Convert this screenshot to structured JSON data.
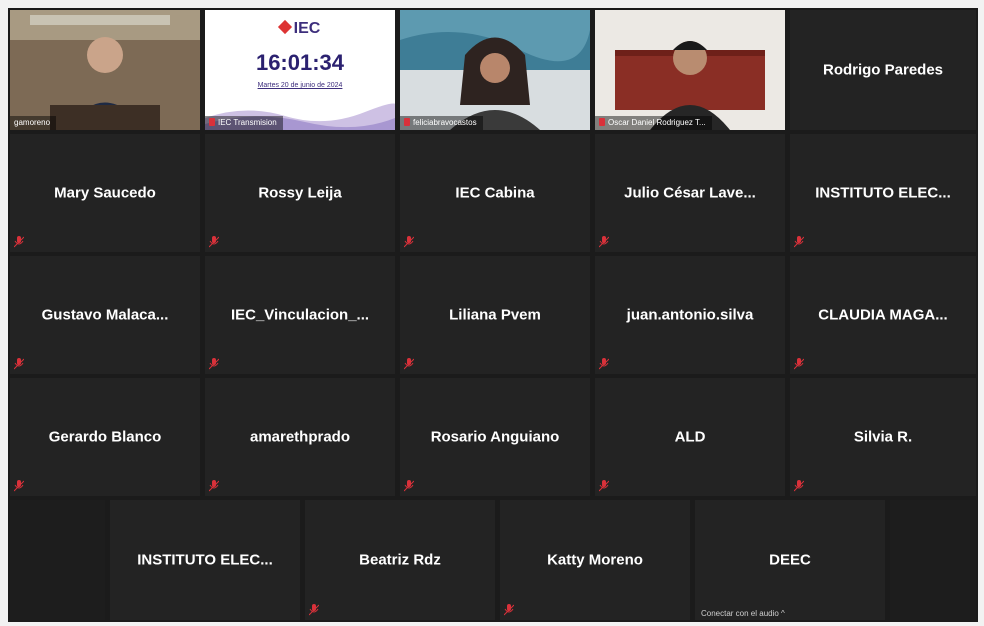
{
  "colors": {
    "mic_muted": "#d9313a",
    "active_speaker_border": "#b8d33c",
    "tile_bg": "#232323"
  },
  "video_tiles": [
    {
      "label": "gamoreno",
      "icon": "mic-muted-icon"
    },
    {
      "label": "IEC Transmision",
      "icon": "mic-muted-icon"
    },
    {
      "label": "feliciabravocastos",
      "icon": "mic-muted-icon",
      "active": true
    },
    {
      "label": "Oscar Daniel Rodriguez T...",
      "icon": "mic-muted-icon"
    }
  ],
  "clock_tile": {
    "logo": "IEC",
    "time": "16:01:34",
    "date": "Martes 20 de junio de 2024"
  },
  "participants": [
    "Rodrigo Paredes",
    "Mary Saucedo",
    "Rossy Leija",
    "IEC Cabina",
    "Julio César Lave...",
    "INSTITUTO ELEC...",
    "Gustavo Malaca...",
    "IEC_Vinculacion_...",
    "Liliana Pvem",
    "juan.antonio.silva",
    "CLAUDIA MAGA...",
    "Gerardo Blanco",
    "amarethprado",
    "Rosario Anguiano",
    "ALD",
    "Silvia R.",
    "INSTITUTO ELEC...",
    "Beatriz Rdz",
    "Katty Moreno",
    "DEEC"
  ],
  "audio_hint": "Conectar con el audio ^"
}
